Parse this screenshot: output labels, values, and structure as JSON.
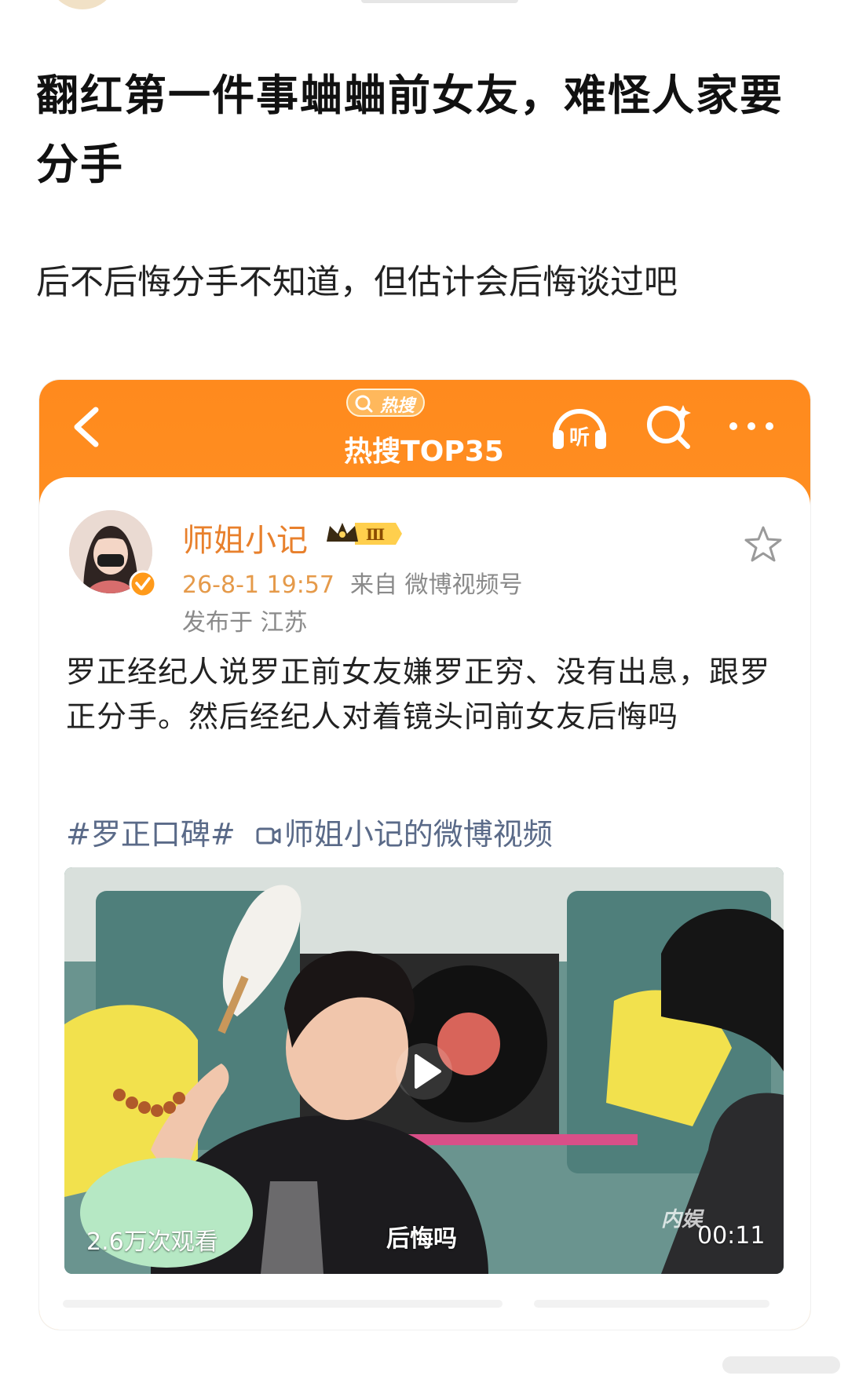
{
  "article": {
    "title": "翻红第一件事蛐蛐前女友，难怪人家要分手",
    "subtitle": "后不后悔分手不知道，但估计会后悔谈过吧"
  },
  "screenshot": {
    "header": {
      "badge": "热搜",
      "title": "热搜TOP35"
    },
    "post": {
      "author": "师姐小记",
      "time": "26-8-1 19:57",
      "source": "来自 微博视频号",
      "location": "发布于 江苏",
      "text": "罗正经纪人说罗正前女友嫌罗正穷、没有出息，跟罗正分手。然后经纪人对着镜头问前女友后悔吗",
      "tag": "#罗正口碑#",
      "video_link": "师姐小记的微博视频"
    },
    "video": {
      "views": "2.6万次观看",
      "caption": "后悔吗",
      "duration": "00:11",
      "logo": "内娱"
    }
  },
  "colors": {
    "header_orange": "#ff8a1d",
    "author_orange": "#e8802c",
    "link_blue": "#5a6a88"
  }
}
